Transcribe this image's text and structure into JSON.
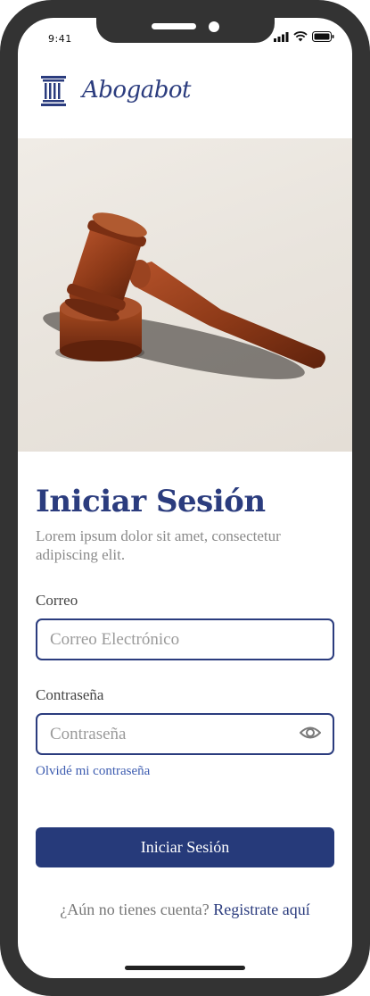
{
  "status_bar": {
    "time": "9:41",
    "icons": [
      "signal-icon",
      "wifi-icon",
      "battery-icon"
    ]
  },
  "brand": {
    "name": "Abogabot",
    "logo_icon": "pillar-icon",
    "color": "#2b3c7e"
  },
  "hero": {
    "image": "gavel-image"
  },
  "login": {
    "title": "Iniciar Sesión",
    "subtitle": "Lorem ipsum dolor sit amet, consectetur adipiscing elit.",
    "email_label": "Correo",
    "email_placeholder": "Correo Electrónico",
    "email_value": "",
    "password_label": "Contraseña",
    "password_placeholder": "Contraseña",
    "password_value": "",
    "password_toggle_icon": "eye-icon",
    "forgot_label": "Olvidé mi contraseña",
    "submit_label": "Iniciar Sesión",
    "signup_question": "¿Aún no tienes cuenta?",
    "signup_link": "Registrate aquí"
  },
  "colors": {
    "primary": "#2b3c7e",
    "button": "#263a7a",
    "link": "#3d5cb0",
    "muted": "#8a8a8a"
  }
}
